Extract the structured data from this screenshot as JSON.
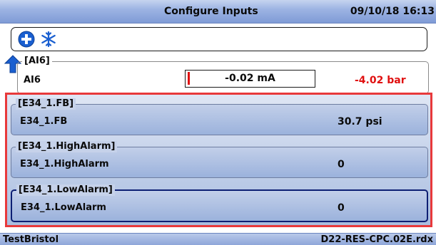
{
  "header": {
    "title": "Configure Inputs",
    "datetime": "09/10/18 16:13"
  },
  "toolbar": {
    "icons": [
      "plus-circle-icon",
      "snowflake-icon"
    ]
  },
  "nav": {
    "icon": "up-arrow-icon"
  },
  "ai6": {
    "group_label": "[AI6]",
    "row_label": "AI6",
    "raw_value": "-0.02 mA",
    "scaled_value": "-4.02 bar",
    "scaled_color": "#e01010"
  },
  "groups": [
    {
      "group_label": "[E34_1.FB]",
      "row_label": "E34_1.FB",
      "value": "30.7 psi"
    },
    {
      "group_label": "[E34_1.HighAlarm]",
      "row_label": "E34_1.HighAlarm",
      "value": "0"
    },
    {
      "group_label": "[E34_1.LowAlarm]",
      "row_label": "E34_1.LowAlarm",
      "value": "0"
    }
  ],
  "colors": {
    "highlight_border": "#e8393b",
    "selected_border": "#0d1f73",
    "accent": "#1a5fd0"
  },
  "status": {
    "left": "TestBristol",
    "right": "D22-RES-CPC.02E.rdx"
  }
}
